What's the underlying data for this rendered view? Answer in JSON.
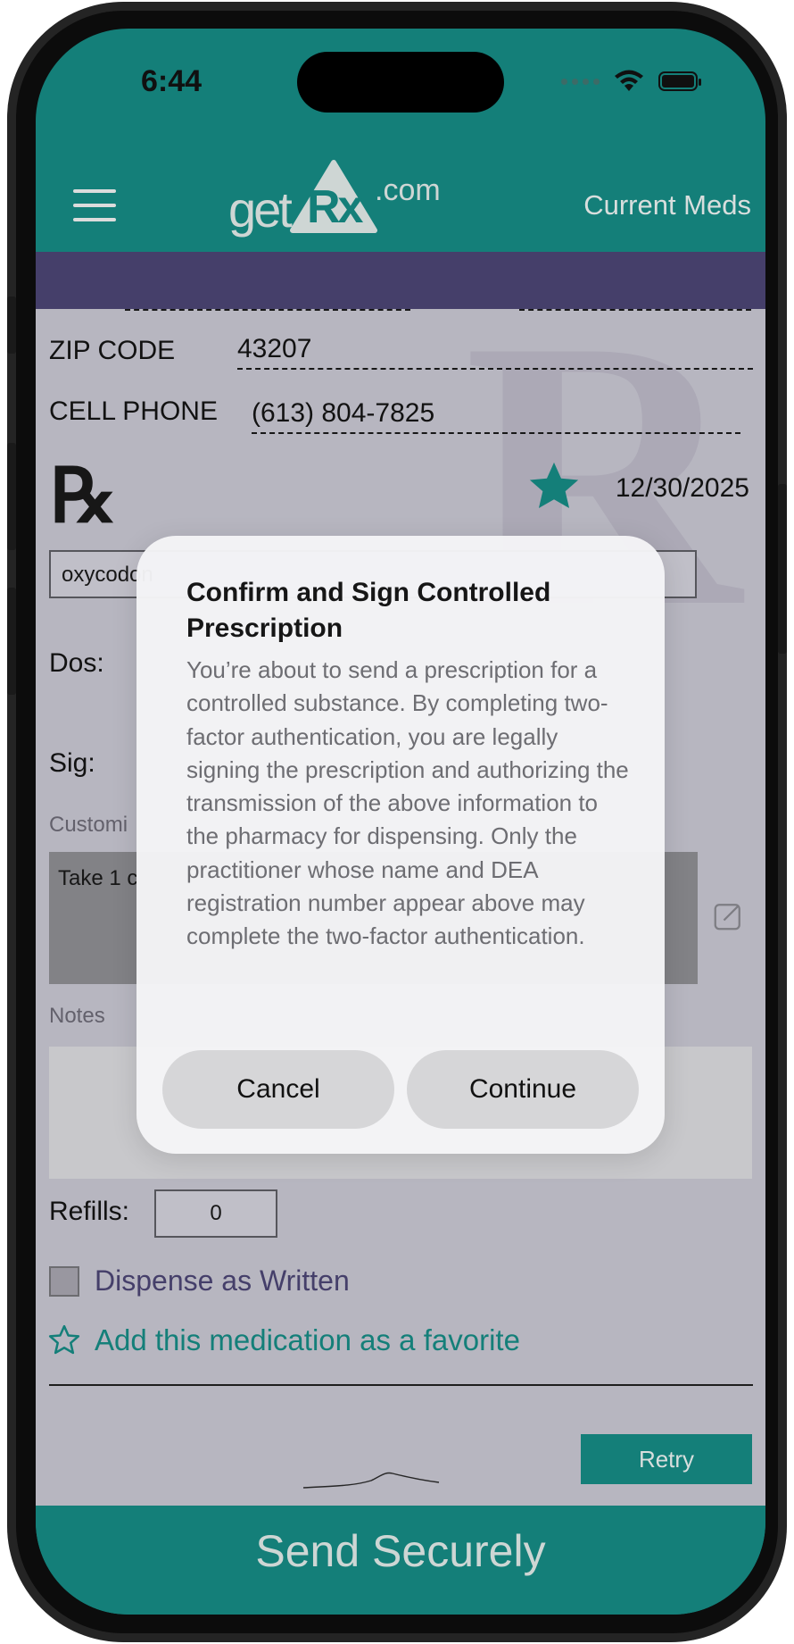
{
  "status_bar": {
    "time": "6:44"
  },
  "header": {
    "logo": {
      "part1": "get",
      "part2": "Rx",
      "part3": ".com"
    },
    "right_link": "Current Meds"
  },
  "form": {
    "zip_label": "ZIP CODE",
    "zip_value": "43207",
    "phone_label": "CELL PHONE",
    "phone_value": "(613) 804-7825",
    "rx_symbol": "℞",
    "date": "12/30/2025",
    "drug_value": "oxycodon",
    "dos_label": "Dos:",
    "sig_label": "Sig:",
    "custom_label": "Customi",
    "sig_text": "Take 1 c",
    "notes_label": "Notes",
    "refills_label": "Refills:",
    "refills_value": "0",
    "dispense_label": "Dispense as Written",
    "favorite_label": "Add this medication as a favorite",
    "retry_label": "Retry",
    "send_label": "Send Securely"
  },
  "dialog": {
    "title": "Confirm and Sign Controlled Prescription",
    "message": "You’re about to send a prescription for a controlled substance. By completing two-factor authentication, you are legally signing the prescription and authorizing the transmission of the above information to the pharmacy for dispensing. Only the practitioner whose name and DEA registration number appear above may complete the two-factor authentication.",
    "cancel": "Cancel",
    "continue": "Continue"
  },
  "colors": {
    "teal": "#168c85",
    "purple": "#4c4675",
    "paper": "#cac8d4"
  }
}
